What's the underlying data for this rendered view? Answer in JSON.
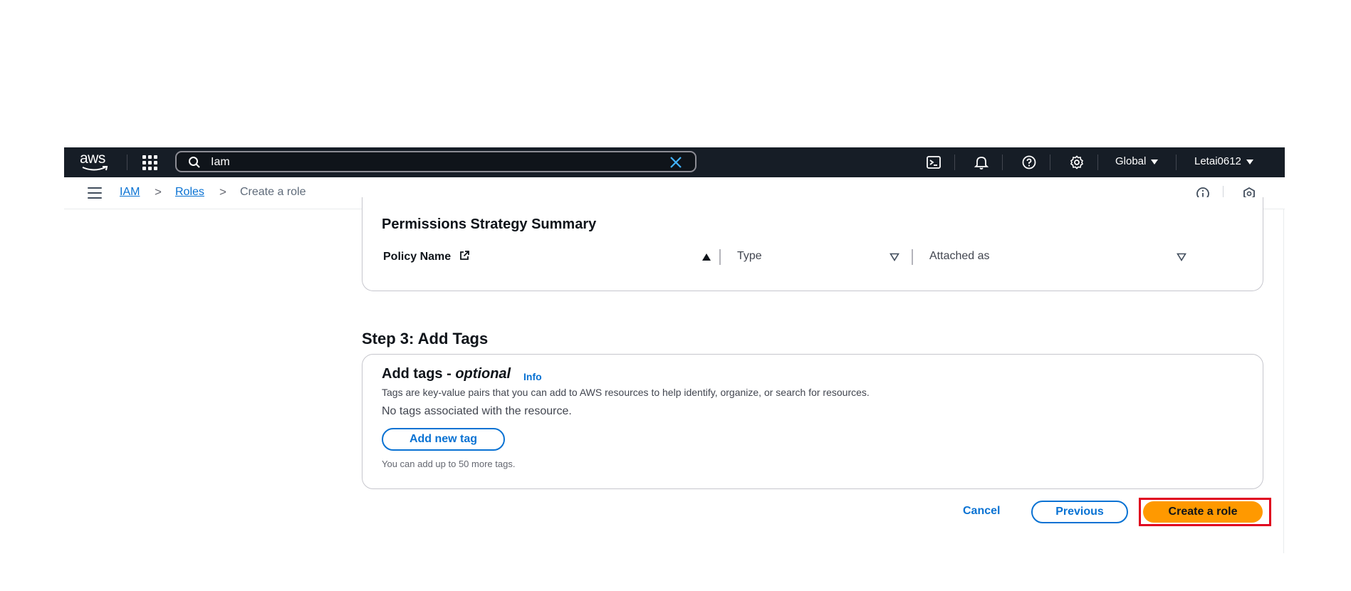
{
  "topnav": {
    "logo_text": "aws",
    "search_value": "Iam",
    "region_label": "Global",
    "account_label": "Letai0612"
  },
  "breadcrumb": {
    "items": [
      "IAM",
      "Roles"
    ],
    "separator": ">",
    "current": "Create a role"
  },
  "permissions_summary": {
    "title": "Permissions Strategy Summary",
    "columns": [
      "Policy Name",
      "Type",
      "Attached as"
    ]
  },
  "step3": {
    "heading": "Step 3: Add Tags",
    "card_title": "Add tags - ",
    "card_title_optional": "optional",
    "info_link": "Info",
    "description": "Tags are key-value pairs that you can add to AWS resources to help identify, organize, or search for resources.",
    "empty_text": "No tags associated with the resource.",
    "add_button": "Add new tag",
    "hint": "You can add up to 50 more tags."
  },
  "actions": {
    "cancel": "Cancel",
    "previous": "Previous",
    "create": "Create a role"
  },
  "colors": {
    "nav_bg": "#161d26",
    "link": "#0972d3",
    "primary_button": "#ff9900",
    "highlight_box": "#e00020"
  },
  "icons": [
    "aws-logo",
    "apps-grid-icon",
    "search-icon",
    "clear-icon",
    "cloudshell-icon",
    "bell-icon",
    "help-icon",
    "gear-icon",
    "caret-down-icon",
    "menu-icon",
    "info-circle-icon",
    "feedback-icon",
    "external-link-icon",
    "sort-ascending-icon",
    "sort-icon"
  ]
}
